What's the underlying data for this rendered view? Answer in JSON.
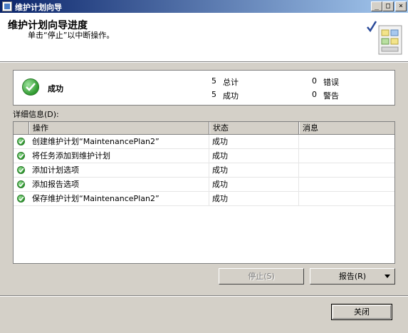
{
  "window": {
    "title": "维护计划向导",
    "controls": {
      "minimize": "_",
      "maximize": "□",
      "close": "×"
    }
  },
  "header": {
    "title": "维护计划向导进度",
    "subtitle": "单击“停止”以中断操作。"
  },
  "summary": {
    "status": "成功",
    "total_count": "5",
    "total_label": "总计",
    "success_count": "5",
    "success_label": "成功",
    "error_count": "0",
    "error_label": "错误",
    "warning_count": "0",
    "warning_label": "警告"
  },
  "details": {
    "label": "详细信息(D):",
    "columns": {
      "action": "操作",
      "status": "状态",
      "message": "消息"
    },
    "rows": [
      {
        "action": "创建维护计划“MaintenancePlan2”",
        "status": "成功",
        "message": ""
      },
      {
        "action": "将任务添加到维护计划",
        "status": "成功",
        "message": ""
      },
      {
        "action": "添加计划选项",
        "status": "成功",
        "message": ""
      },
      {
        "action": "添加报告选项",
        "status": "成功",
        "message": ""
      },
      {
        "action": "保存维护计划“MaintenancePlan2”",
        "status": "成功",
        "message": ""
      }
    ]
  },
  "buttons": {
    "stop": "停止(S)",
    "report": "报告(R)",
    "close": "关闭"
  }
}
